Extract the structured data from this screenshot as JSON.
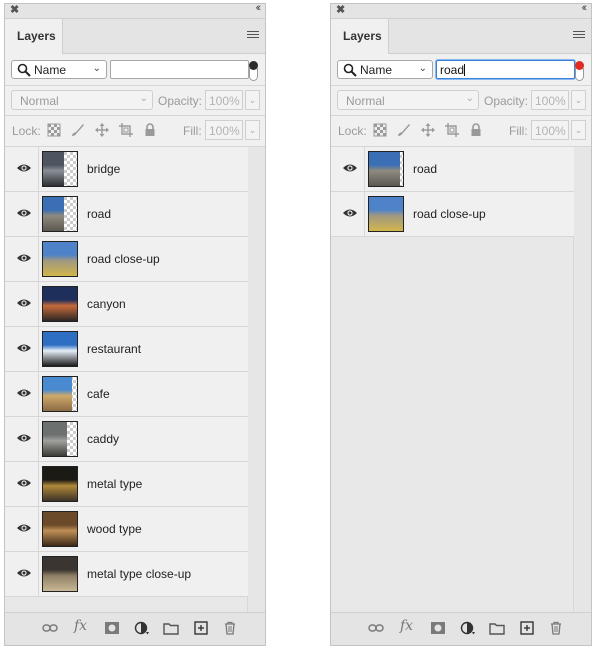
{
  "panels": [
    {
      "title": "Layers",
      "kind_label": "Name",
      "search_value": "",
      "filter_indicator_color": "#2b2b2b",
      "search_focused": false,
      "blend_mode": "Normal",
      "opacity_label": "Opacity:",
      "opacity_value": "100%",
      "lock_label": "Lock:",
      "fill_label": "Fill:",
      "fill_value": "100%",
      "layers": [
        {
          "name": "bridge",
          "thumb_fill": 0.62,
          "colors": [
            "#4e5560",
            "#8a8f96",
            "#2d2f33"
          ]
        },
        {
          "name": "road",
          "thumb_fill": 0.62,
          "colors": [
            "#3a6fb5",
            "#8e8a80",
            "#5b5850"
          ]
        },
        {
          "name": "road close-up",
          "thumb_fill": 1.0,
          "colors": [
            "#4f83c9",
            "#a09880",
            "#d2b64a"
          ]
        },
        {
          "name": "canyon",
          "thumb_fill": 1.0,
          "colors": [
            "#1f2f5c",
            "#c86a3c",
            "#2a2624"
          ]
        },
        {
          "name": "restaurant",
          "thumb_fill": 1.0,
          "colors": [
            "#2e6fc4",
            "#e6eef7",
            "#1b1b1b"
          ]
        },
        {
          "name": "cafe",
          "thumb_fill": 0.85,
          "colors": [
            "#4a8ad0",
            "#cfa96a",
            "#8b6b45"
          ]
        },
        {
          "name": "caddy",
          "thumb_fill": 0.7,
          "colors": [
            "#6c7170",
            "#9fa19c",
            "#3b3a36"
          ]
        },
        {
          "name": "metal type",
          "thumb_fill": 1.0,
          "colors": [
            "#1c1a15",
            "#b08a3a",
            "#3b3127"
          ]
        },
        {
          "name": "wood type",
          "thumb_fill": 1.0,
          "colors": [
            "#6b4a2a",
            "#c08f55",
            "#3b2818"
          ]
        },
        {
          "name": "metal type close-up",
          "thumb_fill": 1.0,
          "colors": [
            "#3a3530",
            "#8f7f66",
            "#c9b894"
          ]
        }
      ]
    },
    {
      "title": "Layers",
      "kind_label": "Name",
      "search_value": "road",
      "filter_indicator_color": "#e02b20",
      "search_focused": true,
      "blend_mode": "Normal",
      "opacity_label": "Opacity:",
      "opacity_value": "100%",
      "lock_label": "Lock:",
      "fill_label": "Fill:",
      "fill_value": "100%",
      "layers": [
        {
          "name": "road",
          "thumb_fill": 0.9,
          "colors": [
            "#3a6fb5",
            "#8e8a80",
            "#5b5850"
          ]
        },
        {
          "name": "road close-up",
          "thumb_fill": 1.0,
          "colors": [
            "#4f83c9",
            "#a09880",
            "#d2b64a"
          ]
        }
      ]
    }
  ],
  "icons": {
    "close": "close-icon",
    "collapse": "double-chevron-icon",
    "menu": "panel-menu-icon",
    "search": "search-icon",
    "visibility": "eye-icon",
    "bottom": [
      "link-icon",
      "fx-icon",
      "mask-icon",
      "adjustment-icon",
      "folder-icon",
      "new-layer-icon",
      "trash-icon"
    ]
  }
}
